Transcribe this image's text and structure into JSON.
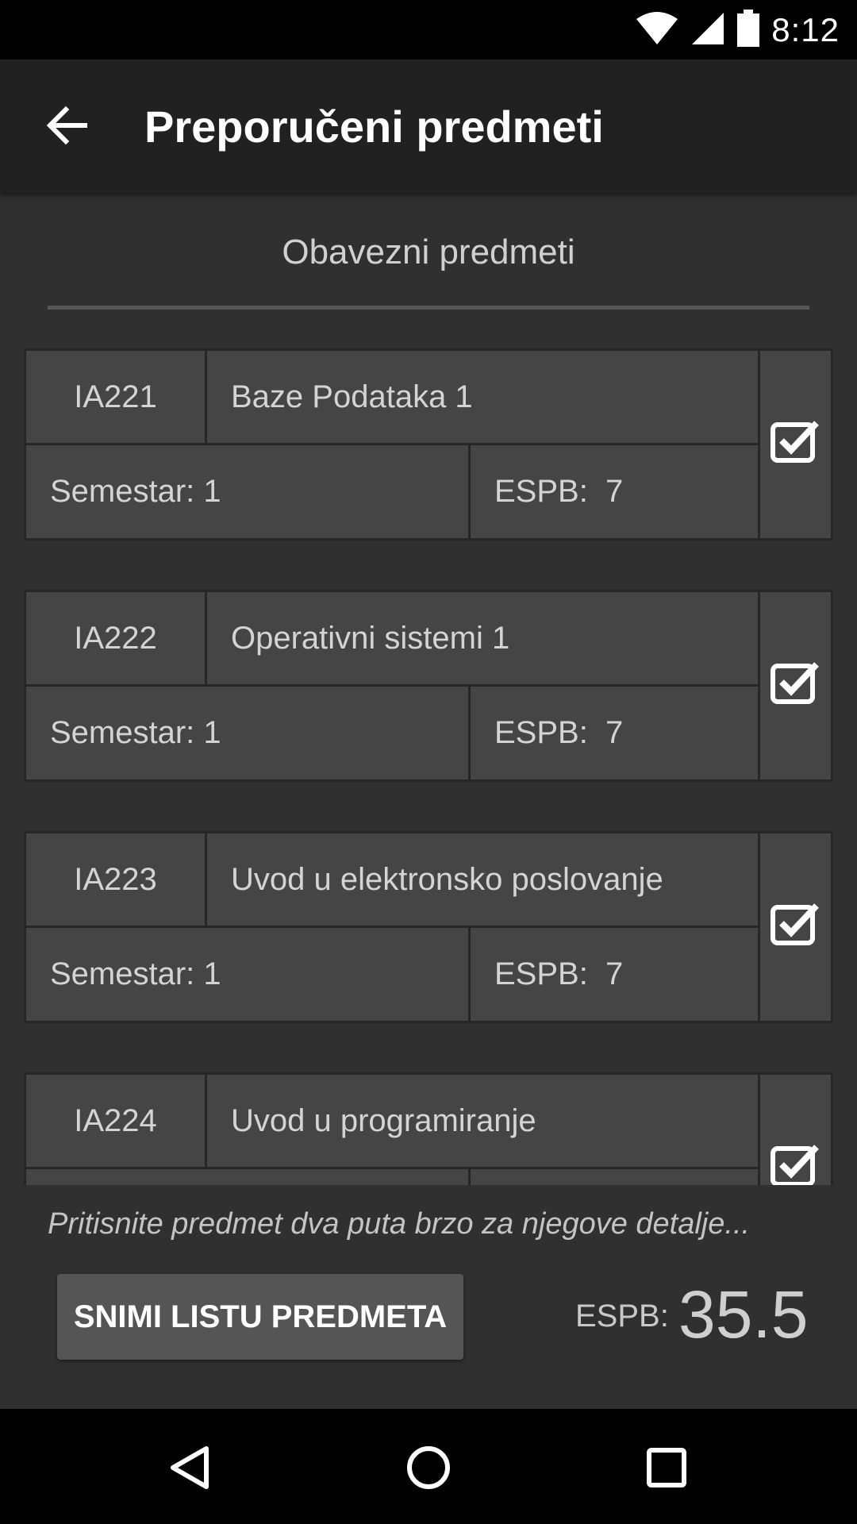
{
  "status_bar": {
    "time": "8:12"
  },
  "app_bar": {
    "title": "Preporučeni predmeti"
  },
  "section": {
    "title": "Obavezni predmeti"
  },
  "courses": [
    {
      "code": "IA221",
      "name": "Baze Podataka 1",
      "semester": "Semestar: 1",
      "espb": "ESPB:  7",
      "checked": true
    },
    {
      "code": "IA222",
      "name": "Operativni sistemi 1",
      "semester": "Semestar: 1",
      "espb": "ESPB:  7",
      "checked": true
    },
    {
      "code": "IA223",
      "name": "Uvod u elektronsko poslovanje",
      "semester": "Semestar: 1",
      "espb": "ESPB:  7",
      "checked": true
    },
    {
      "code": "IA224",
      "name": "Uvod u programiranje",
      "semester": "",
      "espb": "",
      "checked": true
    }
  ],
  "footer": {
    "hint": "Pritisnite predmet dva puta brzo za njegove detalje...",
    "save_label": "SNIMI LISTU PREDMETA",
    "espb_label": "ESPB:",
    "espb_total": "35.5"
  },
  "icons": {
    "wifi": "wifi-icon",
    "signal": "signal-icon",
    "battery": "battery-icon",
    "back": "arrow-back-icon",
    "checkbox": "checkbox-checked-icon",
    "nav_back": "nav-back-icon",
    "nav_home": "nav-home-icon",
    "nav_recents": "nav-recents-icon"
  }
}
